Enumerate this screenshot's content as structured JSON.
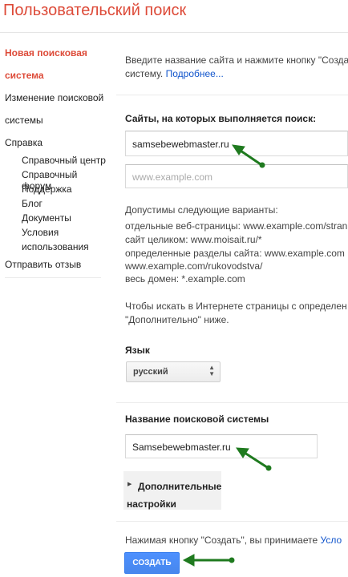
{
  "app": {
    "title": "Пользовательский поиск"
  },
  "sidebar": {
    "items": [
      {
        "label": "Новая поисковая"
      },
      {
        "label": "система"
      },
      {
        "label": "Изменение поисковой"
      },
      {
        "label": "системы"
      },
      {
        "label": "Справка"
      }
    ],
    "help_items": [
      "Справочный центр",
      "Справочный форум",
      "Поддержка",
      "Блог",
      "Документы",
      "Условия",
      "использования"
    ],
    "feedback": "Отправить отзыв"
  },
  "main": {
    "intro_line1": "Введите название сайта и нажмите кнопку \"Создать\"",
    "intro_line2": "систему.",
    "intro_link": "Подробнее...",
    "sites_heading": "Сайты, на которых выполняется поиск:",
    "site_value": "samsebewebmaster.ru",
    "site_placeholder": "www.example.com",
    "allowed_title": "Допустимы следующие варианты:",
    "allowed_lines": [
      "отдельные веб-страницы: www.example.com/stran",
      "сайт целиком: www.moisait.ru/*",
      "определенные разделы сайта: www.example.com",
      "www.example.com/rukovodstva/",
      "весь домен: *.example.com"
    ],
    "web_line1": "Чтобы искать в Интернете страницы с определен",
    "web_line2": "\"Дополнительно\" ниже.",
    "language_label": "Язык",
    "language_value": "русский",
    "engine_name_heading": "Название поисковой системы",
    "engine_name_value": "Samsebewebmaster.ru",
    "advanced_label": "Дополнительные настройки",
    "terms_text": "Нажимая кнопку \"Создать\", вы принимаете",
    "terms_link": "Усло",
    "create_button": "СОЗДАТЬ"
  },
  "colors": {
    "title": "#dd4b39",
    "link": "#1155cc",
    "button": "#4d90fe",
    "annotation_arrow": "#1f7a1f"
  }
}
